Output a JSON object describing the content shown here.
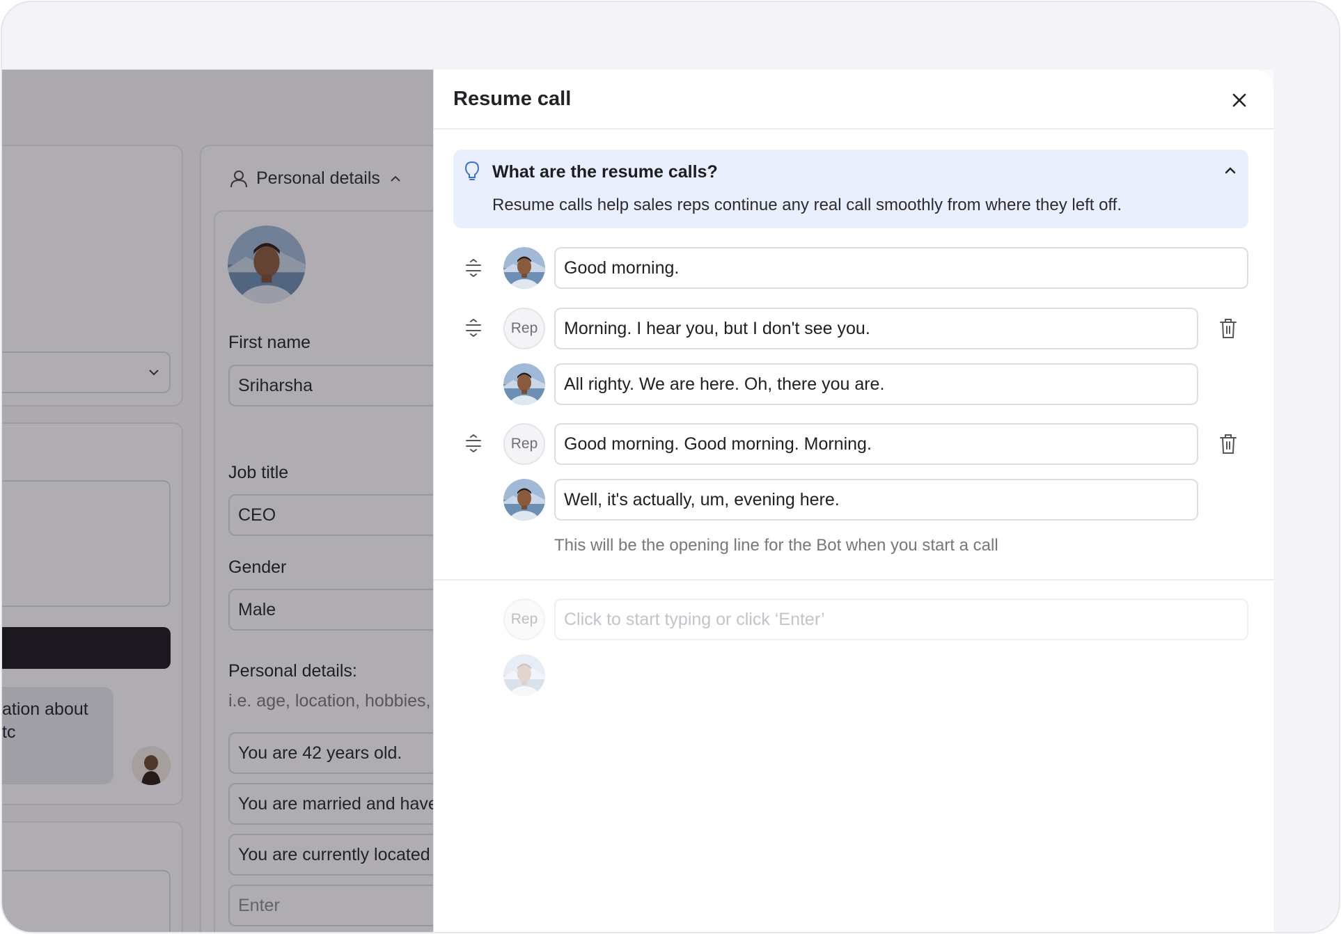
{
  "background": {
    "chat_snippet": [
      "ation about",
      "tc"
    ],
    "personal_section_title": "Personal details",
    "first_name_label": "First name",
    "first_name_value": "Sriharsha",
    "job_title_label": "Job title",
    "job_title_value": "CEO",
    "gender_label": "Gender",
    "gender_value": "Male",
    "personal_details_label": "Personal details:",
    "personal_details_hint": "i.e. age, location, hobbies,",
    "details": [
      "You are 42 years old.",
      "You are married and have",
      "You are currently located"
    ],
    "enter_placeholder": "Enter"
  },
  "panel": {
    "title": "Resume call",
    "info": {
      "question": "What are the resume calls?",
      "answer": "Resume calls help sales reps continue any real call smoothly from where they left off."
    },
    "messages": [
      {
        "speaker": "bot",
        "text": "Good morning."
      },
      {
        "speaker": "rep",
        "speaker_label": "Rep",
        "text": "Morning. I hear you, but I don't see you."
      },
      {
        "speaker": "bot",
        "text": "All righty. We are here. Oh, there you are."
      },
      {
        "speaker": "rep",
        "speaker_label": "Rep",
        "text": "Good morning. Good morning. Morning."
      },
      {
        "speaker": "bot",
        "text": "Well, it's actually, um, evening here."
      }
    ],
    "hint": "This will be the opening line for the Bot when you start a call",
    "new_entry": {
      "speaker_label": "Rep",
      "placeholder": "Click to start typing or click ‘Enter’"
    }
  },
  "colors": {
    "info_bg": "#e9effd",
    "primary_dark": "#18181c",
    "accent_blue": "#3b6fd8"
  }
}
